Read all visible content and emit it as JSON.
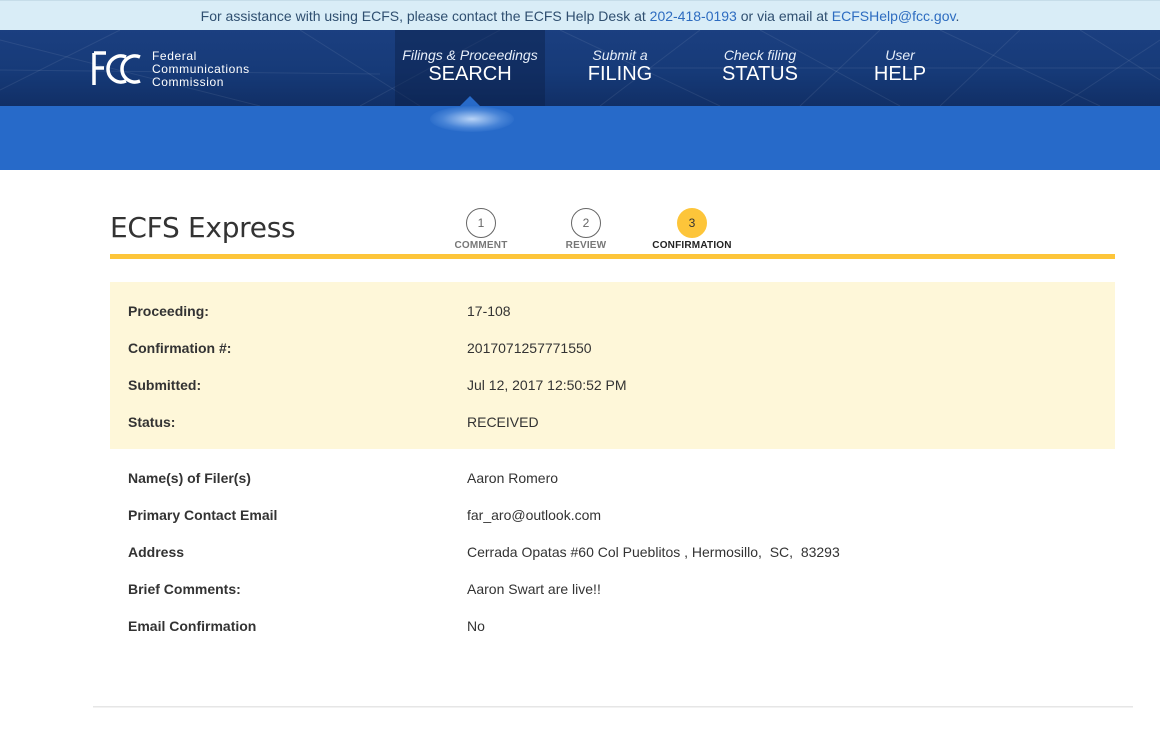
{
  "help_bar": {
    "prefix": "For assistance with using ECFS, please contact the ECFS Help Desk at ",
    "phone": "202-418-0193",
    "middle": " or via email at ",
    "email": "ECFSHelp@fcc.gov",
    "suffix": "."
  },
  "logo": {
    "line1": "Federal",
    "line2": "Communications",
    "line3": "Commission"
  },
  "nav": [
    {
      "small": "Filings & Proceedings",
      "big": "SEARCH",
      "active": true
    },
    {
      "small": "Submit a",
      "big": "FILING",
      "active": false
    },
    {
      "small": "Check filing",
      "big": "STATUS",
      "active": false
    },
    {
      "small": "User",
      "big": "HELP",
      "active": false
    }
  ],
  "page": {
    "title": "ECFS Express"
  },
  "steps": [
    {
      "number": "1",
      "label": "COMMENT"
    },
    {
      "number": "2",
      "label": "REVIEW"
    },
    {
      "number": "3",
      "label": "CONFIRMATION"
    }
  ],
  "summary": [
    {
      "label": "Proceeding:",
      "value": "17-108"
    },
    {
      "label": "Confirmation #:",
      "value": "2017071257771550"
    },
    {
      "label": "Submitted:",
      "value": "Jul 12, 2017 12:50:52 PM"
    },
    {
      "label": "Status:",
      "value": "RECEIVED"
    }
  ],
  "details": [
    {
      "label": "Name(s) of Filer(s)",
      "value": "Aaron Romero"
    },
    {
      "label": "Primary Contact Email",
      "value": "far_aro@outlook.com"
    },
    {
      "label": "Address",
      "value": "Cerrada Opatas #60 Col Pueblitos , Hermosillo,  SC,  83293"
    },
    {
      "label": "Brief Comments:",
      "value": "Aaron Swart are live!!"
    },
    {
      "label": "Email Confirmation",
      "value": "No"
    }
  ],
  "colors": {
    "nav_bg": "#163a78",
    "band_bg": "#276ac9",
    "accent_yellow": "#fdc53a",
    "summary_bg": "#fef7d9",
    "help_bar_bg": "#d9edf7",
    "link": "#2d6cc0"
  },
  "current_step": 3
}
